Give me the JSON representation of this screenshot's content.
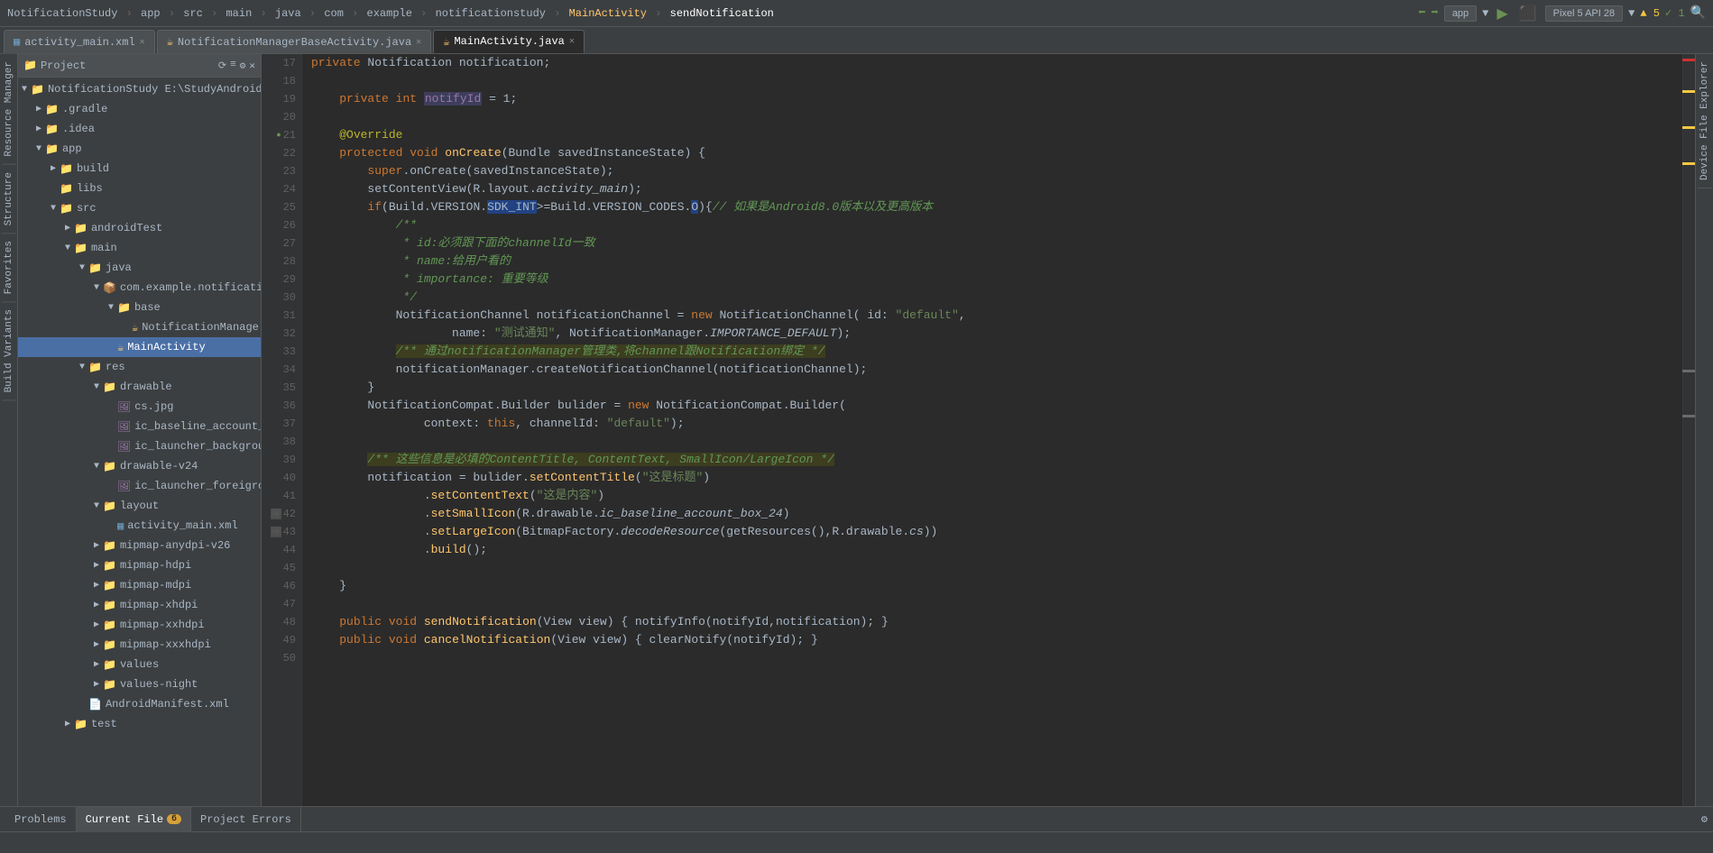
{
  "topbar": {
    "breadcrumbs": [
      {
        "label": "NotificationStudy",
        "active": false
      },
      {
        "label": "app",
        "active": false
      },
      {
        "label": "src",
        "active": false
      },
      {
        "label": "main",
        "active": false
      },
      {
        "label": "java",
        "active": false
      },
      {
        "label": "com",
        "active": false
      },
      {
        "label": "example",
        "active": false
      },
      {
        "label": "notificationstudy",
        "active": false
      },
      {
        "label": "MainActivity",
        "active": false
      },
      {
        "label": "sendNotification",
        "active": true
      }
    ],
    "run_config": "app",
    "device": "Pixel 5 API 28",
    "warnings": "▲ 5",
    "errors": "✓ 1"
  },
  "tabs": [
    {
      "label": "activity_main.xml",
      "type": "xml",
      "active": false,
      "closable": true
    },
    {
      "label": "NotificationManagerBaseActivity.java",
      "type": "java",
      "active": false,
      "closable": true
    },
    {
      "label": "MainActivity.java",
      "type": "java",
      "active": true,
      "closable": true
    }
  ],
  "sidebar": {
    "header": "Project",
    "items": [
      {
        "indent": 0,
        "label": "NotificationStudy E:\\StudyAndroid\\No",
        "type": "project",
        "expanded": true,
        "selected": false
      },
      {
        "indent": 1,
        "label": ".gradle",
        "type": "folder",
        "expanded": false,
        "selected": false
      },
      {
        "indent": 1,
        "label": ".idea",
        "type": "folder",
        "expanded": false,
        "selected": false
      },
      {
        "indent": 1,
        "label": "app",
        "type": "folder",
        "expanded": true,
        "selected": false
      },
      {
        "indent": 2,
        "label": "build",
        "type": "folder",
        "expanded": false,
        "selected": false
      },
      {
        "indent": 2,
        "label": "libs",
        "type": "folder",
        "expanded": false,
        "selected": false
      },
      {
        "indent": 2,
        "label": "src",
        "type": "folder",
        "expanded": true,
        "selected": false
      },
      {
        "indent": 3,
        "label": "androidTest",
        "type": "folder",
        "expanded": false,
        "selected": false
      },
      {
        "indent": 3,
        "label": "main",
        "type": "folder",
        "expanded": true,
        "selected": false
      },
      {
        "indent": 4,
        "label": "java",
        "type": "folder",
        "expanded": true,
        "selected": false
      },
      {
        "indent": 5,
        "label": "com.example.notificatio",
        "type": "package",
        "expanded": true,
        "selected": false
      },
      {
        "indent": 6,
        "label": "base",
        "type": "folder",
        "expanded": true,
        "selected": false
      },
      {
        "indent": 7,
        "label": "NotificationManage",
        "type": "java",
        "expanded": false,
        "selected": false
      },
      {
        "indent": 6,
        "label": "MainActivity",
        "type": "java",
        "expanded": false,
        "selected": true
      },
      {
        "indent": 4,
        "label": "res",
        "type": "folder",
        "expanded": true,
        "selected": false
      },
      {
        "indent": 5,
        "label": "drawable",
        "type": "folder",
        "expanded": true,
        "selected": false
      },
      {
        "indent": 6,
        "label": "cs.jpg",
        "type": "image",
        "expanded": false,
        "selected": false
      },
      {
        "indent": 6,
        "label": "ic_baseline_account_",
        "type": "image",
        "expanded": false,
        "selected": false
      },
      {
        "indent": 6,
        "label": "ic_launcher_backgrou",
        "type": "image",
        "expanded": false,
        "selected": false
      },
      {
        "indent": 5,
        "label": "drawable-v24",
        "type": "folder",
        "expanded": true,
        "selected": false
      },
      {
        "indent": 6,
        "label": "ic_launcher_foreigrou",
        "type": "image",
        "expanded": false,
        "selected": false
      },
      {
        "indent": 5,
        "label": "layout",
        "type": "folder",
        "expanded": true,
        "selected": false
      },
      {
        "indent": 6,
        "label": "activity_main.xml",
        "type": "xml",
        "expanded": false,
        "selected": false
      },
      {
        "indent": 5,
        "label": "mipmap-anydpi-v26",
        "type": "folder",
        "expanded": false,
        "selected": false
      },
      {
        "indent": 5,
        "label": "mipmap-hdpi",
        "type": "folder",
        "expanded": false,
        "selected": false
      },
      {
        "indent": 5,
        "label": "mipmap-mdpi",
        "type": "folder",
        "expanded": false,
        "selected": false
      },
      {
        "indent": 5,
        "label": "mipmap-xhdpi",
        "type": "folder",
        "expanded": false,
        "selected": false
      },
      {
        "indent": 5,
        "label": "mipmap-xxhdpi",
        "type": "folder",
        "expanded": false,
        "selected": false
      },
      {
        "indent": 5,
        "label": "mipmap-xxxhdpi",
        "type": "folder",
        "expanded": false,
        "selected": false
      },
      {
        "indent": 5,
        "label": "values",
        "type": "folder",
        "expanded": false,
        "selected": false
      },
      {
        "indent": 5,
        "label": "values-night",
        "type": "folder",
        "expanded": false,
        "selected": false
      },
      {
        "indent": 4,
        "label": "AndroidManifest.xml",
        "type": "xml",
        "expanded": false,
        "selected": false
      },
      {
        "indent": 3,
        "label": "test",
        "type": "folder",
        "expanded": false,
        "selected": false
      }
    ]
  },
  "editor": {
    "filename": "MainActivity.java",
    "lines": [
      {
        "num": 17,
        "code": "    <kw>private</kw> Notification <type>notification</type>;"
      },
      {
        "num": 18,
        "code": ""
      },
      {
        "num": 19,
        "code": "    <kw>private</kw> <kw>int</kw> <field>notifyId</field> = 1;"
      },
      {
        "num": 20,
        "code": ""
      },
      {
        "num": 21,
        "code": "    <annotation>@Override</annotation>"
      },
      {
        "num": 22,
        "code": "    <kw>protected</kw> <kw>void</kw> <method>onCreate</method>(Bundle savedInstanceState) {"
      },
      {
        "num": 23,
        "code": "        <kw>super</kw>.onCreate(savedInstanceState);"
      },
      {
        "num": 24,
        "code": "        setContentView(R.layout.<em>activity_main</em>);"
      },
      {
        "num": 25,
        "code": "        <kw>if</kw>(Build.VERSION.<highlight>SDK_INT</highlight>>=Build.VERSION_CODES.<highlight>O</highlight>){<comment>// 如果是Android8.0版本以及更高版本</comment>"
      },
      {
        "num": 26,
        "code": "            <comment>/**</comment>"
      },
      {
        "num": 27,
        "code": "             <comment>* id:必须跟下面的channelId一致</comment>"
      },
      {
        "num": 28,
        "code": "             <comment>* name:给用户看的</comment>"
      },
      {
        "num": 29,
        "code": "             <comment>* importance: 重要等级</comment>"
      },
      {
        "num": 30,
        "code": "             <comment>*/</comment>"
      },
      {
        "num": 31,
        "code": "            NotificationChannel <type>notificationChannel</type> = <kw>new</kw> NotificationChannel( id: <string>\"default\"</string>,"
      },
      {
        "num": 32,
        "code": "                    name: <string>\"测试通知\"</string>, NotificationManager.<em>IMPORTANCE_DEFAULT</em>);"
      },
      {
        "num": 33,
        "code": "            <highlight-yellow>/** 通过notificationManager管理类,将channel跟Notification绑定 */</highlight-yellow>"
      },
      {
        "num": 34,
        "code": "            notificationManager.createNotificationChannel(notificationChannel);"
      },
      {
        "num": 35,
        "code": "        }"
      },
      {
        "num": 36,
        "code": "        NotificationCompat.Builder <type>bulider</type> = <kw>new</kw> NotificationCompat.Builder("
      },
      {
        "num": 37,
        "code": "                context: <kw>this</kw>, channelId: <string>\"default\"</string>);"
      },
      {
        "num": 38,
        "code": ""
      },
      {
        "num": 39,
        "code": "        <highlight-yellow>/** 这些信息是必填的ContentTitle, ContentText, SmallIcon/LargeIcon */</highlight-yellow>"
      },
      {
        "num": 40,
        "code": "        notification = bulider.setContentTitle(<string>\"这是标题\"</string>)"
      },
      {
        "num": 41,
        "code": "                .setContentText(<string>\"这是内容\"</string>)"
      },
      {
        "num": 42,
        "code": "                .setSmallIcon(R.drawable.<em>ic_baseline_account_box_24</em>)"
      },
      {
        "num": 43,
        "code": "                .setLargeIcon(BitmapFactory.<em>decodeResource</em>(getResources(),R.drawable.<em>cs</em>))"
      },
      {
        "num": 44,
        "code": "                .build();"
      },
      {
        "num": 45,
        "code": ""
      },
      {
        "num": 46,
        "code": "    }"
      },
      {
        "num": 47,
        "code": ""
      },
      {
        "num": 48,
        "code": "    <kw>public</kw> <kw>void</kw> <method>sendNotification</method>(View view) { notifyInfo(notifyId,notification); }"
      },
      {
        "num": 49,
        "code": "    <kw>public</kw> <kw>void</kw> <method>cancelNotification</method>(View view) { clearNotify(notifyId); }"
      },
      {
        "num": 50,
        "code": ""
      }
    ]
  },
  "statusbar": {
    "tabs": [
      {
        "label": "Problems",
        "active": false
      },
      {
        "label": "Current File",
        "active": true,
        "badge": "6",
        "badge_type": "warning"
      },
      {
        "label": "Project Errors",
        "active": false
      }
    ],
    "right": "⚙"
  },
  "left_side_tabs": [
    "Resource Manager",
    "Structure",
    "Favorites",
    "Build Variants"
  ],
  "right_side_tabs": [
    "Device File Explorer"
  ]
}
